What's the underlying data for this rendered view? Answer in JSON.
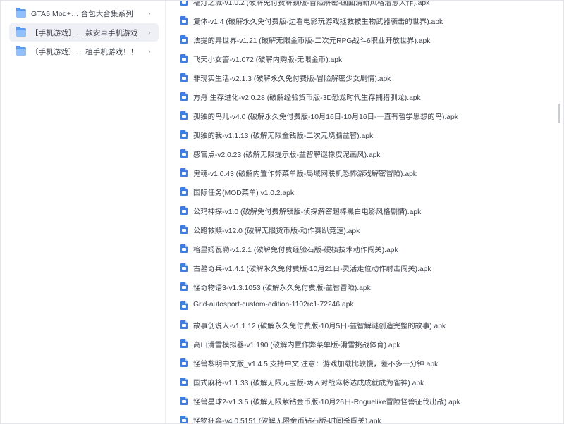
{
  "sidebar": {
    "folders": [
      {
        "label": "GTA5 Mod+…  合包大合集系列",
        "active": false
      },
      {
        "label": "【手机游戏】… 款安卓手机游戏",
        "active": true
      },
      {
        "label": "〔手机游戏〕… 植手机游戏！！",
        "active": false
      }
    ]
  },
  "files": {
    "partial_row": "福灯之城-v1.0.2 (破解免付费解锁版-冒险解密-画面清新风格治愈大作).apk",
    "items": [
      "复体-v1.4 (破解永久免付费版-边看电影玩游戏拯救被生物武器袭击的世界).apk",
      "法提的异世界-v1.21 (破解无限金币版-二次元RPG战斗6职业开放世界).apk",
      "飞天小女警-v1.072 (破解内购版-无限金币).apk",
      "非现实生活-v2.1.3 (破解永久免付费版-冒险解密少女剧情).apk",
      "方舟 生存进化-v2.0.28 (破解经验货币版-3D恐龙时代生存捕猎驯龙).apk",
      "孤独的鸟儿-v4.0 (破解永久免付费版-10月16日-10月16日-一直有哲学思想的鸟).apk",
      "孤独的我-v1.1.13 (破解无限金钱版-二次元烧脑益智).apk",
      "感官点-v2.0.23 (破解无限提示版-益智解谜橡皮泥画风).apk",
      "鬼魂-v1.0.43 (破解内置作弊菜单版-局域网联机恐怖游戏解密冒险).apk",
      "国际任务(MOD菜单) v1.0.2.apk",
      "公鸡神探-v1.0 (破解免付费解锁版-侦探解密超棒黑白电影风格剧情).apk",
      "公路救赎-v12.0 (破解无限货币版-动作赛趴竞速).apk",
      "格里姆瓦勒-v1.2.1 (破解免付费经验石版-硬核技术动作闯关).apk",
      "古墓奇兵-v1.4.1 (破解永久免付费版-10月21日-灵活走位动作射击闯关).apk",
      "怪奇物语3-v1.3.1053 (破解永久免付费版-益智冒险).apk",
      "Grid-autosport-custom-edition-1102rc1-72246.apk",
      "故事创说人-v1.1.12 (破解永久免付费版-10月5日-益智解谜创造完整的故事).apk",
      "高山滑雪模拟器-v1.190 (破解内置作弊菜单版-滑雪挑战体育).apk",
      "怪兽黎明中文版_v1.4.5 支持中文 注意：游戏加载比较慢，差不多一分钟.apk",
      "国式麻将-v1.1.33 (破解无限元宝版-两人对战麻将达成成就成为雀神).apk",
      "怪兽星球2-v1.3.5 (破解无限紫钻金币版-10月26日-Roguelike冒险怪兽征伐出战).apk",
      "怪物狂奔-v4.0.5151 (破解无限金币钻石版-时间杀闯关).apk"
    ]
  },
  "colors": {
    "folder_icon": "#5b9bf0",
    "file_icon": "#3e7ee0",
    "active_row_bg": "#eef0f5"
  },
  "icons": {
    "folder": "folder-icon",
    "chevron": "chevron-right-icon",
    "file": "apk-file-icon"
  }
}
